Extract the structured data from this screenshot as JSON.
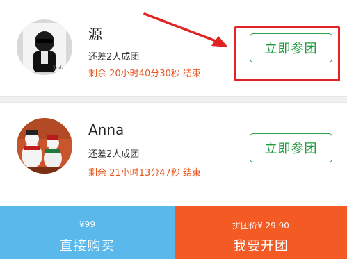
{
  "groups": [
    {
      "name": "源",
      "need_text": "还差2人成团",
      "remaining_text": "剩余 20小时40分30秒 结束",
      "join_label": "立即参团",
      "avatar_icon": "user-avatar-photo-sunglasses"
    },
    {
      "name": "Anna",
      "need_text": "还差2人成团",
      "remaining_text": "剩余 21小时13分47秒 结束",
      "join_label": "立即参团",
      "avatar_icon": "user-avatar-photo-snowmen"
    }
  ],
  "bottom": {
    "buy_price": "¥99",
    "buy_label": "直接购买",
    "group_price": "拼团价¥ 29.90",
    "group_label": "我要开团"
  },
  "colors": {
    "accent_green": "#1f9b3f",
    "countdown_orange": "#e8551d",
    "buy_blue": "#5ab8ea",
    "group_orange": "#f35a24",
    "annotation_red": "#e02424"
  }
}
